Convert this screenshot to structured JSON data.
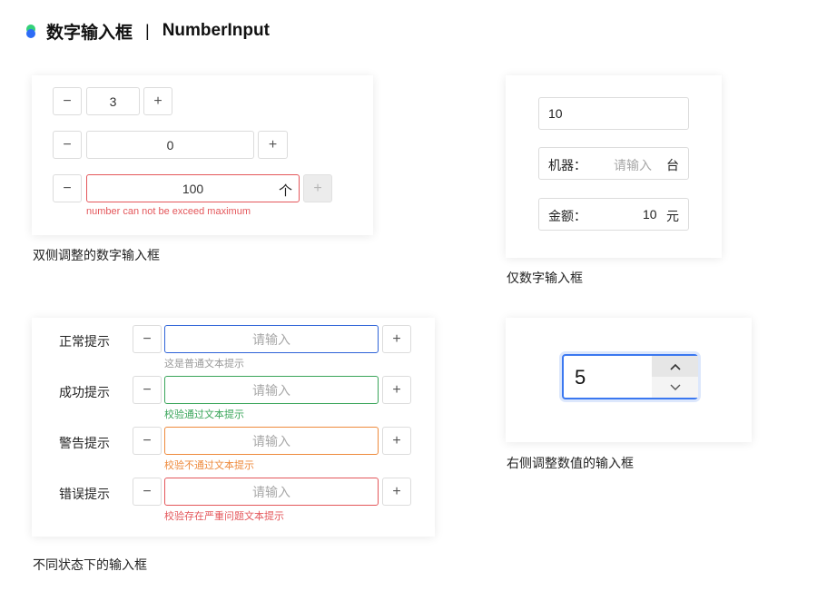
{
  "header": {
    "title": "数字输入框",
    "separator": "|",
    "subtitle": "NumberInput"
  },
  "section1": {
    "caption": "双侧调整的数字输入框",
    "minus": "−",
    "plus": "+",
    "row1_value": "3",
    "row2_value": "0",
    "row3_value": "100",
    "row3_unit": "个",
    "error": "number can not be exceed maximum"
  },
  "section2": {
    "caption": "仅数字输入框",
    "input1_value": "10",
    "machine_label": "机器：",
    "machine_placeholder": "请输入",
    "machine_unit": "台",
    "amount_label": "金额：",
    "amount_value": "10",
    "amount_unit": "元"
  },
  "section3": {
    "caption": "不同状态下的输入框",
    "placeholder": "请输入",
    "minus": "−",
    "plus": "+",
    "rows": [
      {
        "label": "正常提示",
        "hint": "这是普通文本提示",
        "color": "#2f64d8",
        "hint_color": "#9a9a9a"
      },
      {
        "label": "成功提示",
        "hint": "校验通过文本提示",
        "color": "#3aa55a",
        "hint_color": "#3aa55a"
      },
      {
        "label": "警告提示",
        "hint": "校验不通过文本提示",
        "color": "#ee8a3c",
        "hint_color": "#ee8a3c"
      },
      {
        "label": "错误提示",
        "hint": "校验存在严重问题文本提示",
        "color": "#e4575b",
        "hint_color": "#e4575b"
      }
    ]
  },
  "section4": {
    "caption": "右侧调整数值的输入框",
    "value": "5",
    "accent": "#3b78f0"
  },
  "icons": {
    "up": "chevron-up-icon",
    "down": "chevron-down-icon"
  }
}
